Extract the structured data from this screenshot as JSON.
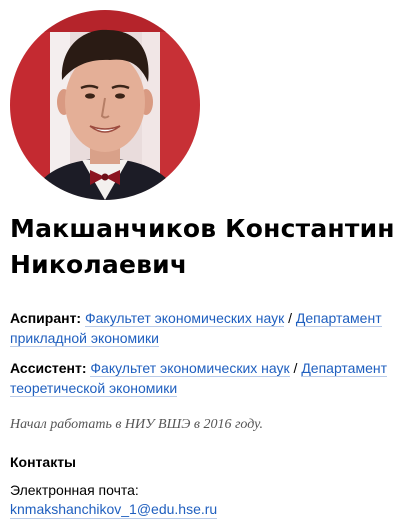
{
  "profile": {
    "avatar_alt": "Фото",
    "name": "Макшанчиков Константин Николаевич",
    "positions": [
      {
        "role": "Аспирант:",
        "faculty": "Факультет экономических наук",
        "separator": " / ",
        "department": "Департамент прикладной экономики"
      },
      {
        "role": "Ассистент:",
        "faculty": "Факультет экономических наук",
        "separator": " / ",
        "department": "Департамент теоретической экономики"
      }
    ],
    "intro": "Начал работать в НИУ ВШЭ в 2016 году."
  },
  "contacts": {
    "title": "Контакты",
    "email_label": "Электронная почта:",
    "email": "knmakshanchikov_1@edu.hse.ru"
  },
  "colors": {
    "link": "#1f5fbf",
    "intro_text": "#555555"
  }
}
